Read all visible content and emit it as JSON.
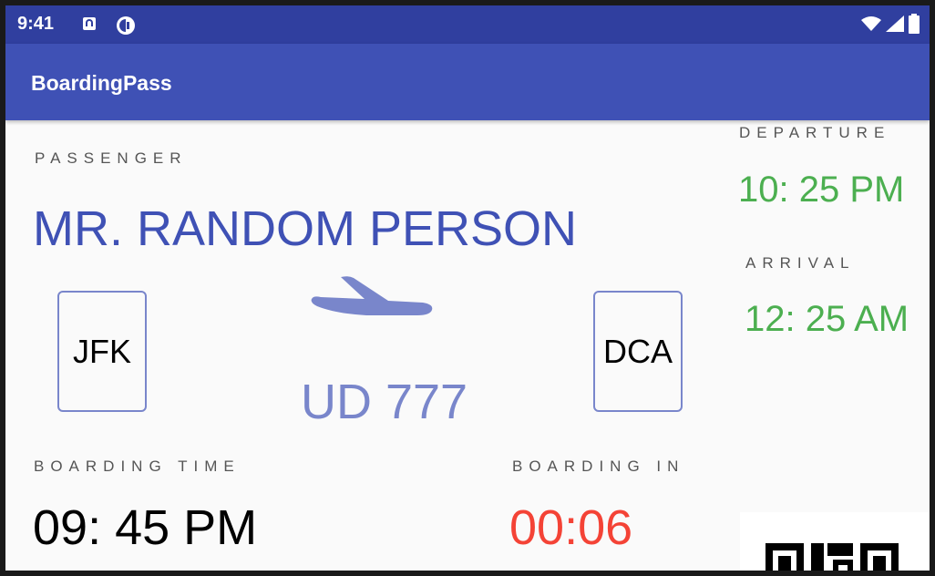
{
  "status_bar": {
    "time": "9:41",
    "left_icons": [
      "notification-a-icon",
      "notification-c-icon"
    ],
    "right_icons": [
      "wifi-icon",
      "signal-icon",
      "battery-icon"
    ]
  },
  "app_bar": {
    "title": "BoardingPass"
  },
  "passenger": {
    "label": "PASSENGER",
    "name": "MR. RANDOM PERSON"
  },
  "route": {
    "origin": "JFK",
    "destination": "DCA",
    "flight_number": "UD 777",
    "icon": "airplane-icon"
  },
  "departure": {
    "label": "DEPARTURE",
    "time": "10: 25 PM"
  },
  "arrival": {
    "label": "ARRIVAL",
    "time": "12: 25 AM"
  },
  "boarding_time": {
    "label": "BOARDING TIME",
    "time": "09: 45 PM"
  },
  "boarding_in": {
    "label": "BOARDING IN",
    "countdown": "00:06"
  },
  "qr": {
    "icon": "qr-code-icon"
  },
  "colors": {
    "status_bar": "#303f9f",
    "app_bar": "#3f51b5",
    "accent": "#7986cb",
    "time_green": "#4caf50",
    "countdown_red": "#f44336"
  }
}
